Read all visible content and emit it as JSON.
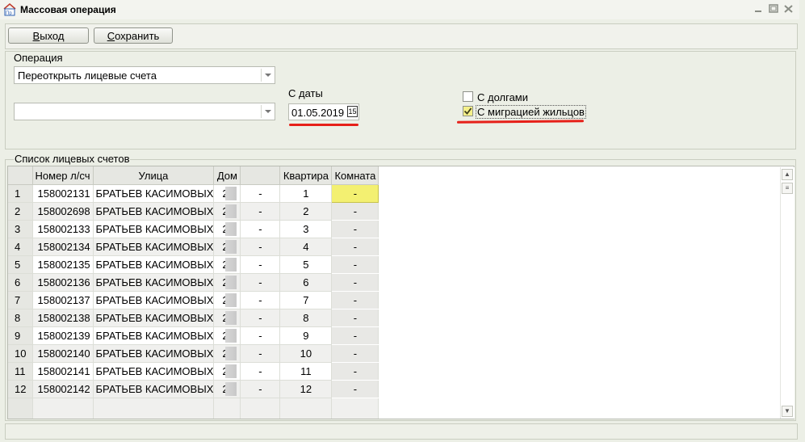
{
  "window": {
    "title": "Массовая операция",
    "icon": "app-logo-icon"
  },
  "toolbar": {
    "exit_label": "Выход",
    "exit_mnemonic": "В",
    "exit_rest": "ыход",
    "save_label": "Сохранить",
    "save_mnemonic": "С",
    "save_rest": "охранить"
  },
  "operation": {
    "group_label": "Операция",
    "selected": "Переоткрыть лицевые счета",
    "second_combo_value": "",
    "date_label": "С даты",
    "date_value": "01.05.2019",
    "calendar_icon": "calendar-icon",
    "calendar_text": "15",
    "debts_label": "С долгами",
    "debts_checked": false,
    "migration_label": "С миграцией жильцов",
    "migration_checked": true
  },
  "accounts": {
    "group_label": "Список лицевых счетов",
    "columns": [
      "",
      "Номер л/сч",
      "Улица",
      "Дом",
      "",
      "Квартира",
      "Комната"
    ],
    "rows": [
      {
        "n": "1",
        "account": "158002131",
        "street": "БРАТЬЕВ КАСИМОВЫХ",
        "house": "2",
        "corp": "-",
        "flat": "1",
        "room": "-"
      },
      {
        "n": "2",
        "account": "158002698",
        "street": "БРАТЬЕВ КАСИМОВЫХ",
        "house": "2",
        "corp": "-",
        "flat": "2",
        "room": "-"
      },
      {
        "n": "3",
        "account": "158002133",
        "street": "БРАТЬЕВ КАСИМОВЫХ",
        "house": "2",
        "corp": "-",
        "flat": "3",
        "room": "-"
      },
      {
        "n": "4",
        "account": "158002134",
        "street": "БРАТЬЕВ КАСИМОВЫХ",
        "house": "2",
        "corp": "-",
        "flat": "4",
        "room": "-"
      },
      {
        "n": "5",
        "account": "158002135",
        "street": "БРАТЬЕВ КАСИМОВЫХ",
        "house": "2",
        "corp": "-",
        "flat": "5",
        "room": "-"
      },
      {
        "n": "6",
        "account": "158002136",
        "street": "БРАТЬЕВ КАСИМОВЫХ",
        "house": "2",
        "corp": "-",
        "flat": "6",
        "room": "-"
      },
      {
        "n": "7",
        "account": "158002137",
        "street": "БРАТЬЕВ КАСИМОВЫХ",
        "house": "2",
        "corp": "-",
        "flat": "7",
        "room": "-"
      },
      {
        "n": "8",
        "account": "158002138",
        "street": "БРАТЬЕВ КАСИМОВЫХ",
        "house": "2",
        "corp": "-",
        "flat": "8",
        "room": "-"
      },
      {
        "n": "9",
        "account": "158002139",
        "street": "БРАТЬЕВ КАСИМОВЫХ",
        "house": "2",
        "corp": "-",
        "flat": "9",
        "room": "-"
      },
      {
        "n": "10",
        "account": "158002140",
        "street": "БРАТЬЕВ КАСИМОВЫХ",
        "house": "2",
        "corp": "-",
        "flat": "10",
        "room": "-"
      },
      {
        "n": "11",
        "account": "158002141",
        "street": "БРАТЬЕВ КАСИМОВЫХ",
        "house": "2",
        "corp": "-",
        "flat": "11",
        "room": "-"
      },
      {
        "n": "12",
        "account": "158002142",
        "street": "БРАТЬЕВ КАСИМОВЫХ",
        "house": "2",
        "corp": "-",
        "flat": "12",
        "room": "-"
      }
    ]
  },
  "colors": {
    "highlight": "#f3f071",
    "annotation": "#e62019",
    "background": "#ecefe6"
  }
}
